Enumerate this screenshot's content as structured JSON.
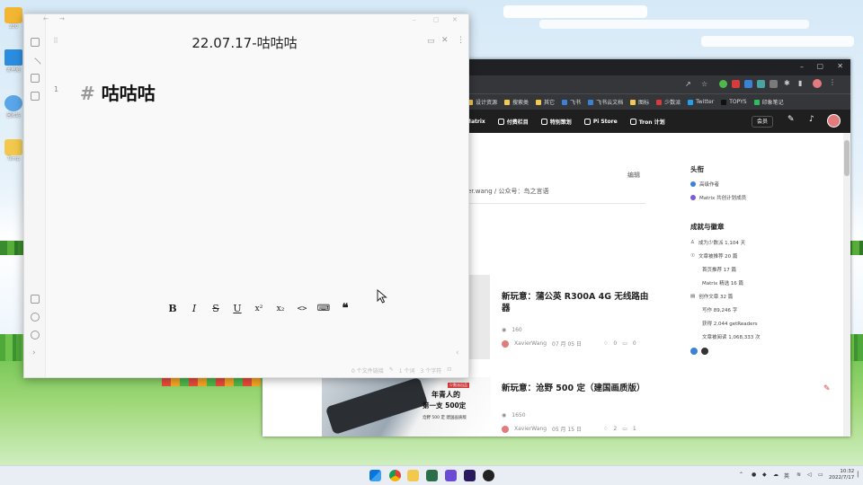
{
  "desktop": {
    "icons": [
      {
        "name": "user-folder",
        "label": "200",
        "color": "#f2b632"
      },
      {
        "name": "this-pc",
        "label": "此电脑",
        "color": "#2c8de0"
      },
      {
        "name": "recycle-bin",
        "label": "回收站",
        "color": "#5aa6e8"
      },
      {
        "name": "temp-folder",
        "label": "Temp",
        "color": "#f2c94c"
      }
    ]
  },
  "editor": {
    "title": "22.07.17-咕咕咕",
    "line_number": "1",
    "heading_mark": "#",
    "heading_text": "咕咕咕",
    "toolbar": {
      "bold": "B",
      "italic": "I",
      "strike": "S",
      "underline": "U",
      "superscript": "x²",
      "subscript": "x₂",
      "code": "<>",
      "code_block": "⌨",
      "quote": "❝"
    },
    "status": {
      "blocks": "0 个文件链接",
      "words": "1 个词",
      "chars": "3 个字符"
    }
  },
  "browser": {
    "bookmarks": [
      "设计资源",
      "搜索类",
      "其它",
      "飞书",
      "飞书云文档",
      "图标",
      "少数派",
      "Twitter",
      "TOPYS",
      "印象笔记"
    ],
    "nav": [
      {
        "icon": "matrix-icon",
        "label": "Matrix"
      },
      {
        "icon": "column-icon",
        "label": "付费栏目"
      },
      {
        "icon": "star-icon",
        "label": "特别策划"
      },
      {
        "icon": "pi-icon",
        "label": "Pi Store"
      },
      {
        "icon": "tron-icon",
        "label": "Tron 计划"
      }
    ],
    "member_label": "会员",
    "profile": {
      "edit_label": "编辑",
      "bio": "er.wang / 公众号：鸟之言语"
    },
    "sidebar": {
      "headline_title": "头衔",
      "headlines": [
        "高级作者",
        "Matrix 共创计划成员"
      ],
      "achievements_title": "成就与徽章",
      "achievements": [
        "成为少数派 1,104 天",
        "文章被推荐 20 篇",
        "首页推荐 17 篇",
        "Matrix 精选 16 篇",
        "创作文章 32 篇",
        "写作 89,246 字",
        "获得 2,044 getReaders",
        "文章被阅读 1,068,333 次"
      ]
    },
    "articles": [
      {
        "title": "新玩意：蒲公英 R300A 4G 无线路由器",
        "views": "160",
        "author": "XavierWang",
        "date": "07 月 05 日",
        "likes": "0",
        "comments": "0"
      },
      {
        "title": "新玩意：沧野 500 定（建国画质版）",
        "views": "1650",
        "author": "XavierWang",
        "date": "05 月 15 日",
        "likes": "2",
        "comments": "1",
        "thumb_text": [
          "年青人的",
          "第一支 500定",
          "沧野 500 定 建国画质版"
        ],
        "thumb_badge": "少数派出品"
      }
    ]
  },
  "taskbar": {
    "time": "10:32",
    "date": "2022/7/17",
    "lang": "英"
  },
  "colors": {
    "browser_chrome": "#35363a",
    "site_nav": "#1f1f1f",
    "accent_red": "#d73b3b"
  }
}
